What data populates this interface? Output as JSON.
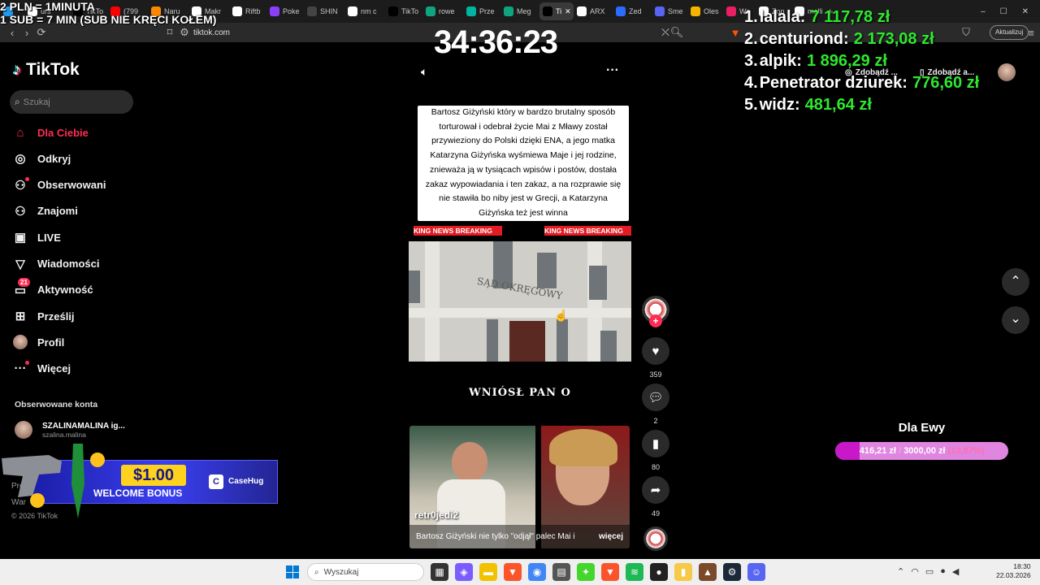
{
  "overlay_top_left": {
    "line1": "2 PLN = 1MINUTA",
    "line2": "1 SUB = 7 MIN (SUB NIE KRĘCI KOŁEM)"
  },
  "browser": {
    "tabs": [
      {
        "label": "",
        "icon": "box-icon",
        "color": "#1d9bf0"
      },
      {
        "label": "urs",
        "icon": "google-icon",
        "color": "#ffffff"
      },
      {
        "label": "TikTo",
        "icon": "tiktok-icon",
        "color": "#000000"
      },
      {
        "label": "(799",
        "icon": "youtube-icon",
        "color": "#ff0000"
      },
      {
        "label": "Naru",
        "icon": "fire-icon",
        "color": "#ff8800"
      },
      {
        "label": "Makr",
        "icon": "window-icon",
        "color": "#ffffff"
      },
      {
        "label": "Riftb",
        "icon": "square-icon",
        "color": "#ffffff"
      },
      {
        "label": "Poke",
        "icon": "m-icon",
        "color": "#8a3ffc"
      },
      {
        "label": "SHIN",
        "icon": "",
        "color": "#444444"
      },
      {
        "label": "nm c",
        "icon": "google-icon",
        "color": "#ffffff"
      },
      {
        "label": "TikTo",
        "icon": "tiktok-icon",
        "color": "#000000"
      },
      {
        "label": "rowe",
        "icon": "chatgpt-icon",
        "color": "#10a37f"
      },
      {
        "label": "Prze",
        "icon": "v-icon",
        "color": "#00b4a0"
      },
      {
        "label": "Meg",
        "icon": "chatgpt-icon",
        "color": "#10a37f"
      },
      {
        "label": "Ti",
        "icon": "speaker-icon",
        "color": "#000000",
        "active": true
      },
      {
        "label": "ARX",
        "icon": "circle-icon",
        "color": "#ffffff"
      },
      {
        "label": "Zed",
        "icon": "z-icon",
        "color": "#2b6cff"
      },
      {
        "label": "Sme",
        "icon": "discord-icon",
        "color": "#5865f2"
      },
      {
        "label": "Oles",
        "icon": "doc-icon",
        "color": "#f4b400"
      },
      {
        "label": "We",
        "icon": "w-icon",
        "color": "#e91e63"
      },
      {
        "label": "Zon",
        "icon": "google-icon",
        "color": "#ffffff"
      },
      {
        "label": "malli",
        "icon": "google-icon",
        "color": "#ffffff"
      }
    ],
    "url": "tiktok.com",
    "update_button": "Aktualizuj"
  },
  "tiktok": {
    "logo": "TikTok",
    "search_placeholder": "Szukaj",
    "nav": [
      {
        "label": "Dla Ciebie",
        "icon": "home-icon"
      },
      {
        "label": "Odkryj",
        "icon": "compass-icon"
      },
      {
        "label": "Obserwowani",
        "icon": "following-icon"
      },
      {
        "label": "Znajomi",
        "icon": "friends-icon"
      },
      {
        "label": "LIVE",
        "icon": "live-icon"
      },
      {
        "label": "Wiadomości",
        "icon": "send-icon"
      },
      {
        "label": "Aktywność",
        "icon": "activity-icon",
        "badge": "21"
      },
      {
        "label": "Prześlij",
        "icon": "upload-icon"
      },
      {
        "label": "Profil",
        "icon": "avatar"
      },
      {
        "label": "Więcej",
        "icon": "more-icon"
      }
    ],
    "followed_title": "Obserwowane konta",
    "followed": {
      "name": "SZALINAMALINA ig...",
      "handle": "szalina.malina"
    },
    "footer_partial": [
      "Progra",
      "War",
      "© 2026 TikTok"
    ],
    "get_app_1": "Zdobądź ...",
    "get_app_2": "Zdobądź a..."
  },
  "video": {
    "timer": "34:36:23",
    "caption": "Bartosz Giżyński który w bardzo brutalny sposób torturował i odebrał życie Mai z Mławy został przywieziony do Polski dzięki ENA, a jego matka Katarzyna Giżyńska wyśmiewa Maje i jej rodzine, znieważa ją w tysiącach wpisów i postów, dostała zakaz wypowiadania i ten zakaz, a na rozprawie się nie stawiła bo niby jest w Grecji, a Katarzyna Giżyńska też jest winna",
    "breaking_left": "KING NEWS   BREAKING",
    "breaking_right": "KING NEWS   BREAKING",
    "building_sign": "SĄD OKRĘGOWY",
    "headline": "WNIÓSŁ PAN O",
    "thumb_user": "retr0jedi2",
    "thumb_caption": "Bartosz Giżyński nie tylko \"odjął\" palec Mai i",
    "thumb_more": "więcej"
  },
  "actions": {
    "likes": "359",
    "comments": "2",
    "saves": "80",
    "shares": "49"
  },
  "leaderboard": [
    {
      "rank": "1.",
      "name": "lalala:",
      "amount": "7 117,78 zł"
    },
    {
      "rank": "2.",
      "name": "centuriond:",
      "amount": "2 173,08 zł"
    },
    {
      "rank": "3.",
      "name": "alpik:",
      "amount": "1 896,29 zł"
    },
    {
      "rank": "4.",
      "name": "Penetrator dziurek:",
      "amount": "776,60 zł"
    },
    {
      "rank": "5.",
      "name": "widz:",
      "amount": "481,64 zł"
    }
  ],
  "goal": {
    "title": "Dla Ewy",
    "current": "416,21 zł",
    "target": "3000,00 zł",
    "percent_label": "(13,87%)",
    "progress": 0.1387
  },
  "ad": {
    "amount": "$1.00",
    "text": "WELCOME BONUS",
    "brand": "CaseHug"
  },
  "taskbar": {
    "search_placeholder": "Wyszukaj",
    "time": "18:30",
    "date": "22.03.2026"
  }
}
